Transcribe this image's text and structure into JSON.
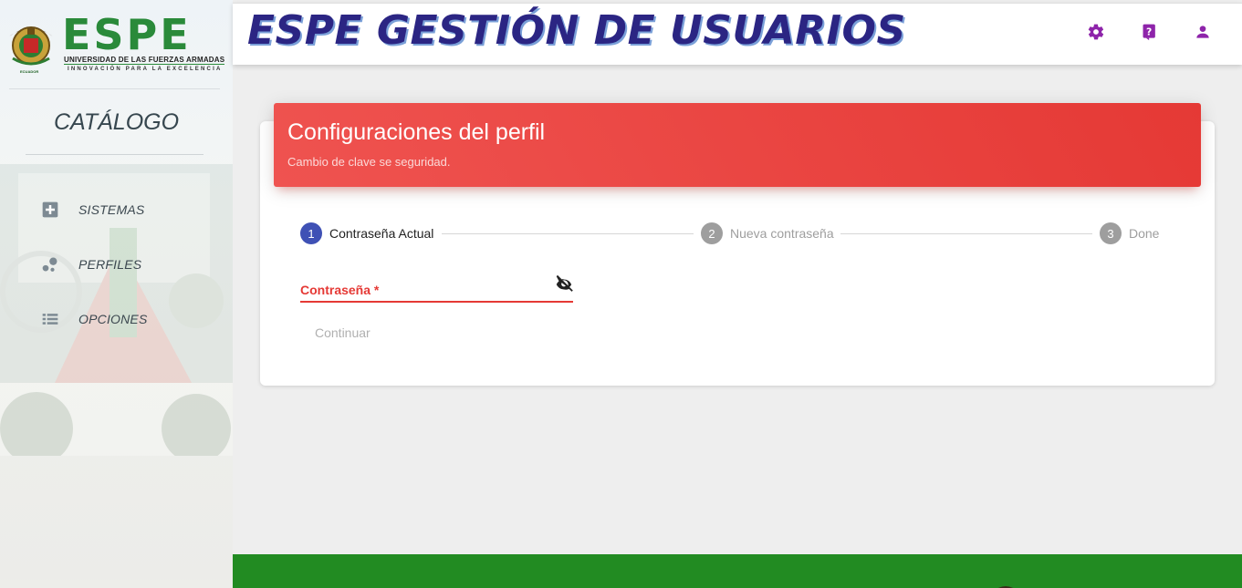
{
  "colors": {
    "accent_red": "#e53935",
    "header_title": "#2b2583",
    "icon_purple": "#8e24aa",
    "footer_green": "#228b22",
    "step_active": "#3f51b5",
    "step_inactive": "#9e9e9e"
  },
  "logo": {
    "wordmark": "ESPE",
    "university": "UNIVERSIDAD DE LAS FUERZAS ARMADAS",
    "motto": "INNOVACIÓN PARA LA EXCELENCIA",
    "country": "ECUADOR"
  },
  "sidebar": {
    "title": "CATÁLOGO",
    "items": [
      {
        "label": "SISTEMAS",
        "icon": "add-box-icon"
      },
      {
        "label": "PERFILES",
        "icon": "bubbles-icon"
      },
      {
        "label": "OPCIONES",
        "icon": "list-icon"
      }
    ]
  },
  "header": {
    "title": "ESPE GESTIÓN DE USUARIOS",
    "actions": [
      {
        "icon": "gear-icon"
      },
      {
        "icon": "help-icon"
      },
      {
        "icon": "user-icon"
      }
    ]
  },
  "card": {
    "title": "Configuraciones del perfil",
    "subtitle": "Cambio de clave se seguridad."
  },
  "stepper": {
    "steps": [
      {
        "number": "1",
        "label": "Contraseña Actual",
        "active": true
      },
      {
        "number": "2",
        "label": "Nueva contraseña",
        "active": false
      },
      {
        "number": "3",
        "label": "Done",
        "active": false
      }
    ]
  },
  "form": {
    "password_label": "Contraseña *",
    "toggle_icon": "eye-off-icon",
    "continue_label": "Continuar"
  }
}
